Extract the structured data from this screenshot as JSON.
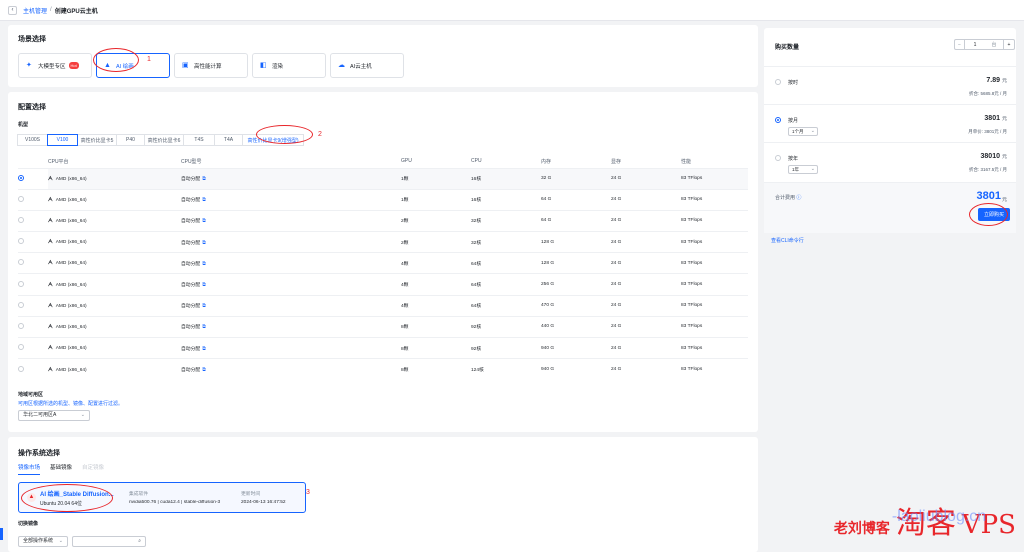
{
  "breadcrumb": {
    "parent": "主机管理",
    "separator": "/",
    "current": "创建GPU云主机"
  },
  "scene": {
    "title": "场景选择",
    "items": [
      {
        "label": "大模型专区",
        "badge": "Hot",
        "icon": "sparkle-icon"
      },
      {
        "label": "AI 绘画",
        "icon": "paint-icon"
      },
      {
        "label": "高性能计算",
        "icon": "compute-icon"
      },
      {
        "label": "渲染",
        "icon": "render-icon"
      },
      {
        "label": "AI云主机",
        "icon": "cloud-host-icon"
      }
    ],
    "annotation": "1"
  },
  "config": {
    "title": "配置选择",
    "model_label": "机型",
    "models": [
      "V100S",
      "V100",
      "高性价比显卡5",
      "P40",
      "高性价比显卡6",
      "T4S",
      "T4A",
      "高性价比显卡9(增强型)"
    ],
    "annotation": "2",
    "columns": [
      "CPU平台",
      "CPU型号",
      "GPU",
      "CPU",
      "内存",
      "显存",
      "性能"
    ],
    "rows": [
      {
        "platform": "AMD (x86_64)",
        "model": "自动分配",
        "gpu": "1颗",
        "cpu": "16核",
        "mem": "32 G",
        "vram": "24 G",
        "perf": "83 TFlops"
      },
      {
        "platform": "AMD (x86_64)",
        "model": "自动分配",
        "gpu": "1颗",
        "cpu": "16核",
        "mem": "64 G",
        "vram": "24 G",
        "perf": "83 TFlops"
      },
      {
        "platform": "AMD (x86_64)",
        "model": "自动分配",
        "gpu": "2颗",
        "cpu": "32核",
        "mem": "64 G",
        "vram": "24 G",
        "perf": "83 TFlops"
      },
      {
        "platform": "AMD (x86_64)",
        "model": "自动分配",
        "gpu": "2颗",
        "cpu": "32核",
        "mem": "128 G",
        "vram": "24 G",
        "perf": "83 TFlops"
      },
      {
        "platform": "AMD (x86_64)",
        "model": "自动分配",
        "gpu": "4颗",
        "cpu": "64核",
        "mem": "128 G",
        "vram": "24 G",
        "perf": "83 TFlops"
      },
      {
        "platform": "AMD (x86_64)",
        "model": "自动分配",
        "gpu": "4颗",
        "cpu": "64核",
        "mem": "256 G",
        "vram": "24 G",
        "perf": "83 TFlops"
      },
      {
        "platform": "AMD (x86_64)",
        "model": "自动分配",
        "gpu": "4颗",
        "cpu": "64核",
        "mem": "470 G",
        "vram": "24 G",
        "perf": "83 TFlops"
      },
      {
        "platform": "AMD (x86_64)",
        "model": "自动分配",
        "gpu": "8颗",
        "cpu": "92核",
        "mem": "440 G",
        "vram": "24 G",
        "perf": "83 TFlops"
      },
      {
        "platform": "AMD (x86_64)",
        "model": "自动分配",
        "gpu": "8颗",
        "cpu": "92核",
        "mem": "940 G",
        "vram": "24 G",
        "perf": "83 TFlops"
      },
      {
        "platform": "AMD (x86_64)",
        "model": "自动分配",
        "gpu": "8颗",
        "cpu": "124核",
        "mem": "940 G",
        "vram": "24 G",
        "perf": "83 TFlops"
      }
    ],
    "region_title": "地域可用区",
    "region_hint": "可用区根据所选的机型、镜像、配置进行过滤。",
    "region_value": "华北二可用区A"
  },
  "os": {
    "title": "操作系统选择",
    "tabs": [
      "镜像市场",
      "基础镜像",
      "自定镜像"
    ],
    "image": {
      "name": "AI 绘画_Stable Diffusion...",
      "version": "Ubuntu 20.04 64位",
      "components_label": "集成软件",
      "components": "nvidia500.76  |  cuda12.4  |  stable-diffusion-3",
      "updated_label": "更新时间",
      "updated": "2024-06-13 16:47:52"
    },
    "annotation": "3",
    "switch_label": "切换镜像",
    "filter_value": "全部操作系统"
  },
  "purchase": {
    "qty_label": "购买数量",
    "qty": "1",
    "qty_unit": "台",
    "minus": "−",
    "plus": "+",
    "options": [
      {
        "label": "按时",
        "price": "7.89",
        "unit": "元",
        "note": "折合: 5685.8元 / 月"
      },
      {
        "label": "按月",
        "price": "3801",
        "unit": "元",
        "note": "月单价: 3801元 / 月",
        "select": "1个月"
      },
      {
        "label": "按年",
        "price": "38010",
        "unit": "元",
        "note": "折合: 3167.5元 / 月",
        "select": "1年"
      }
    ],
    "total_label": "合计费用",
    "total": "3801",
    "total_unit": "元",
    "buy_label": "立即购买",
    "cli_link": "查看CLI命令行"
  },
  "watermark": {
    "left": "老刘博客",
    "blog": "-laoliublog.cn",
    "cn": "淘客",
    "vps": "VPS"
  },
  "colors": {
    "accent": "#1664ff",
    "annotation": "#e8262b",
    "bg": "#f2f3f5"
  }
}
